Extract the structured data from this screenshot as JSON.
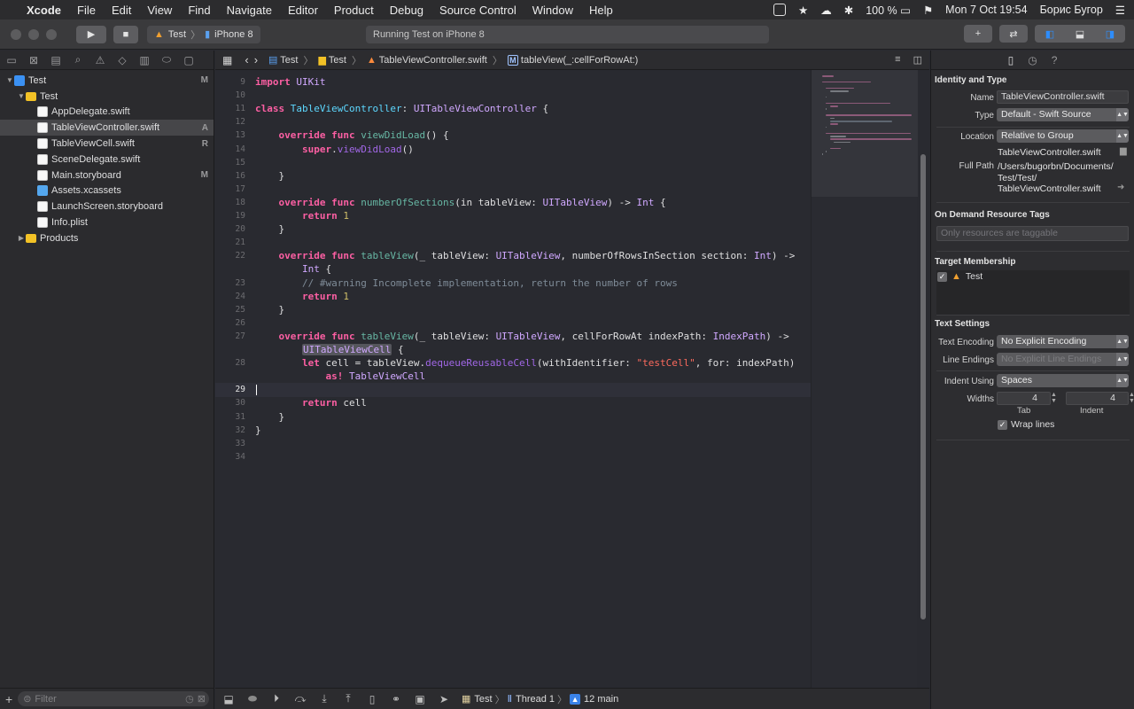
{
  "menubar": {
    "app": "Xcode",
    "menus": [
      "File",
      "Edit",
      "View",
      "Find",
      "Navigate",
      "Editor",
      "Product",
      "Debug",
      "Source Control",
      "Window",
      "Help"
    ],
    "battery": "100 %",
    "datetime": "Mon 7 Oct  19:54",
    "user": "Борис Бугор"
  },
  "toolbar": {
    "scheme": "Test",
    "destination": "iPhone 8",
    "activity": "Running Test on iPhone 8"
  },
  "navigator": {
    "items": [
      {
        "label": "Test",
        "badge": "M",
        "depth": 0,
        "icon": "project-icon",
        "disclosure": "▼"
      },
      {
        "label": "Test",
        "badge": "",
        "depth": 1,
        "icon": "folder-icon",
        "disclosure": "▼"
      },
      {
        "label": "AppDelegate.swift",
        "badge": "",
        "depth": 2,
        "icon": "swift-file-icon",
        "disclosure": ""
      },
      {
        "label": "TableViewController.swift",
        "badge": "A",
        "depth": 2,
        "icon": "swift-file-icon",
        "disclosure": "",
        "selected": true
      },
      {
        "label": "TableViewCell.swift",
        "badge": "R",
        "depth": 2,
        "icon": "swift-file-icon",
        "disclosure": ""
      },
      {
        "label": "SceneDelegate.swift",
        "badge": "",
        "depth": 2,
        "icon": "swift-file-icon",
        "disclosure": ""
      },
      {
        "label": "Main.storyboard",
        "badge": "M",
        "depth": 2,
        "icon": "storyboard-icon",
        "disclosure": ""
      },
      {
        "label": "Assets.xcassets",
        "badge": "",
        "depth": 2,
        "icon": "asset-catalog-icon",
        "disclosure": ""
      },
      {
        "label": "LaunchScreen.storyboard",
        "badge": "",
        "depth": 2,
        "icon": "storyboard-icon",
        "disclosure": ""
      },
      {
        "label": "Info.plist",
        "badge": "",
        "depth": 2,
        "icon": "plist-icon",
        "disclosure": ""
      },
      {
        "label": "Products",
        "badge": "",
        "depth": 1,
        "icon": "folder-icon",
        "disclosure": "▶"
      }
    ],
    "filter_placeholder": "Filter"
  },
  "jumpbar": {
    "crumbs": [
      "Test",
      "Test",
      "TableViewController.swift",
      "tableView(_:cellForRowAt:)"
    ]
  },
  "editor": {
    "current_line": "29",
    "lines": [
      {
        "n": "9",
        "t": "import UIKit"
      },
      {
        "n": "10",
        "t": ""
      },
      {
        "n": "11",
        "t": "class TableViewController: UITableViewController {"
      },
      {
        "n": "12",
        "t": ""
      },
      {
        "n": "13",
        "t": "    override func viewDidLoad() {"
      },
      {
        "n": "14",
        "t": "        super.viewDidLoad()"
      },
      {
        "n": "15",
        "t": ""
      },
      {
        "n": "16",
        "t": "    }"
      },
      {
        "n": "17",
        "t": ""
      },
      {
        "n": "18",
        "t": "    override func numberOfSections(in tableView: UITableView) -> Int {"
      },
      {
        "n": "19",
        "t": "        return 1"
      },
      {
        "n": "20",
        "t": "    }"
      },
      {
        "n": "21",
        "t": ""
      },
      {
        "n": "22",
        "t": "    override func tableView(_ tableView: UITableView, numberOfRowsInSection section: Int) ->"
      },
      {
        "n": "",
        "t": "        Int {"
      },
      {
        "n": "23",
        "t": "        // #warning Incomplete implementation, return the number of rows"
      },
      {
        "n": "24",
        "t": "        return 1"
      },
      {
        "n": "25",
        "t": "    }"
      },
      {
        "n": "26",
        "t": ""
      },
      {
        "n": "27",
        "t": "    override func tableView(_ tableView: UITableView, cellForRowAt indexPath: IndexPath) ->"
      },
      {
        "n": "",
        "t": "        UITableViewCell {"
      },
      {
        "n": "28",
        "t": "        let cell = tableView.dequeueReusableCell(withIdentifier: \"testCell\", for: indexPath)"
      },
      {
        "n": "",
        "t": "            as! TableViewCell"
      },
      {
        "n": "29",
        "t": ""
      },
      {
        "n": "30",
        "t": "        return cell"
      },
      {
        "n": "31",
        "t": "    }"
      },
      {
        "n": "32",
        "t": "}"
      },
      {
        "n": "33",
        "t": ""
      },
      {
        "n": "34",
        "t": ""
      }
    ]
  },
  "debugbar": {
    "process": "Test",
    "thread": "Thread 1",
    "frame": "12 main"
  },
  "inspector": {
    "identity_title": "Identity and Type",
    "name_label": "Name",
    "name_value": "TableViewController.swift",
    "type_label": "Type",
    "type_value": "Default - Swift Source",
    "location_label": "Location",
    "location_value": "Relative to Group",
    "location_file": "TableViewController.swift",
    "fullpath_label": "Full Path",
    "fullpath_lines": [
      "/Users/bugorbn/Documents/",
      "Test/Test/",
      "TableViewController.swift"
    ],
    "odr_title": "On Demand Resource Tags",
    "odr_placeholder": "Only resources are taggable",
    "target_title": "Target Membership",
    "target_name": "Test",
    "text_settings_title": "Text Settings",
    "encoding_label": "Text Encoding",
    "encoding_value": "No Explicit Encoding",
    "line_endings_label": "Line Endings",
    "line_endings_value": "No Explicit Line Endings",
    "indent_using_label": "Indent Using",
    "indent_using_value": "Spaces",
    "widths_label": "Widths",
    "tab_value": "4",
    "indent_value": "4",
    "tab_caption": "Tab",
    "indent_caption": "Indent",
    "wrap_label": "Wrap lines"
  }
}
